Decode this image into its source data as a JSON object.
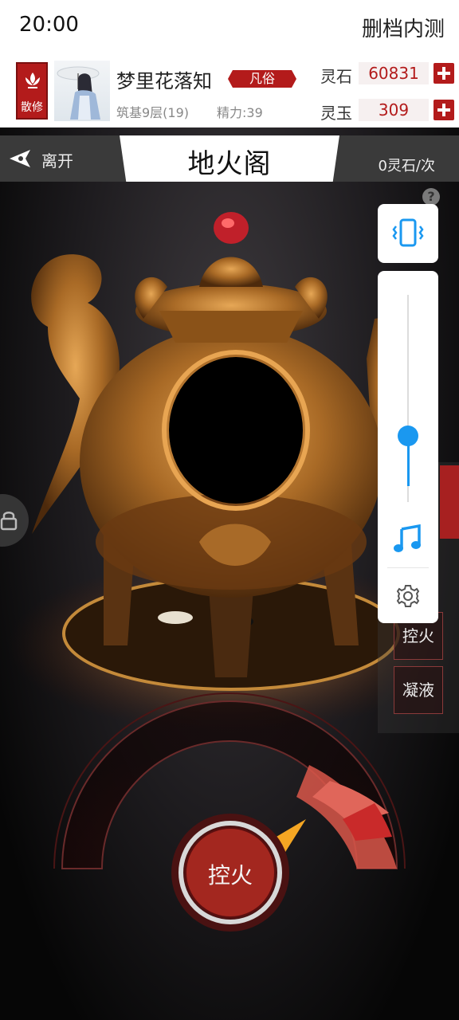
{
  "status_bar": {
    "time": "20:00",
    "tag": "删档内测"
  },
  "player": {
    "sect_label": "散修",
    "name": "梦里花落知",
    "rank": "凡俗",
    "level": "筑基9层(19)",
    "energy": "精力:39"
  },
  "currencies": [
    {
      "label": "灵石",
      "value": "60831"
    },
    {
      "label": "灵玉",
      "value": "309"
    }
  ],
  "scene": {
    "leave_label": "离开",
    "title": "地火阁",
    "cost": "0灵石/次",
    "help_label": "?"
  },
  "side_buttons": {
    "control_fire": "控火",
    "condense": "凝液"
  },
  "volume": {
    "level": 0.28
  },
  "main_action": {
    "label": "控火"
  },
  "colors": {
    "accent_red": "#b31b1b",
    "slider_blue": "#1a98f0",
    "bronze": "#c48a3a"
  }
}
